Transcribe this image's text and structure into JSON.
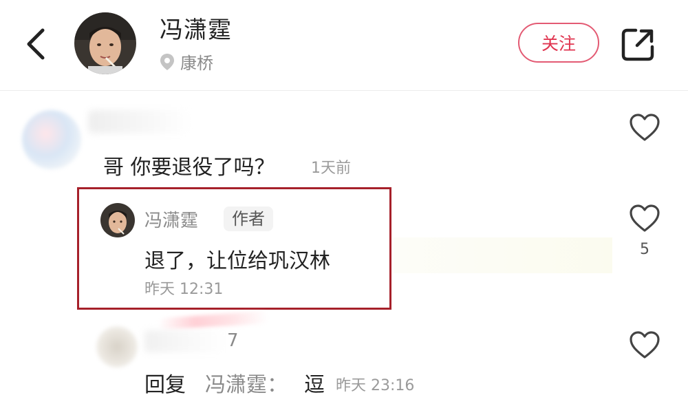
{
  "header": {
    "user_name": "冯潇霆",
    "location": "康桥",
    "follow_label": "关注"
  },
  "comments": [
    {
      "text": "哥 你要退役了吗？",
      "time": "1天前",
      "reply": {
        "name": "冯潇霆",
        "tag": "作者",
        "text": "退了，让位给巩汉林",
        "time": "昨天 12:31",
        "likes": "5"
      }
    }
  ],
  "reply3": {
    "name_tail": "7",
    "prefix": "回复",
    "to": "冯潇霆：",
    "body": "逗",
    "time": "昨天 23:16"
  }
}
